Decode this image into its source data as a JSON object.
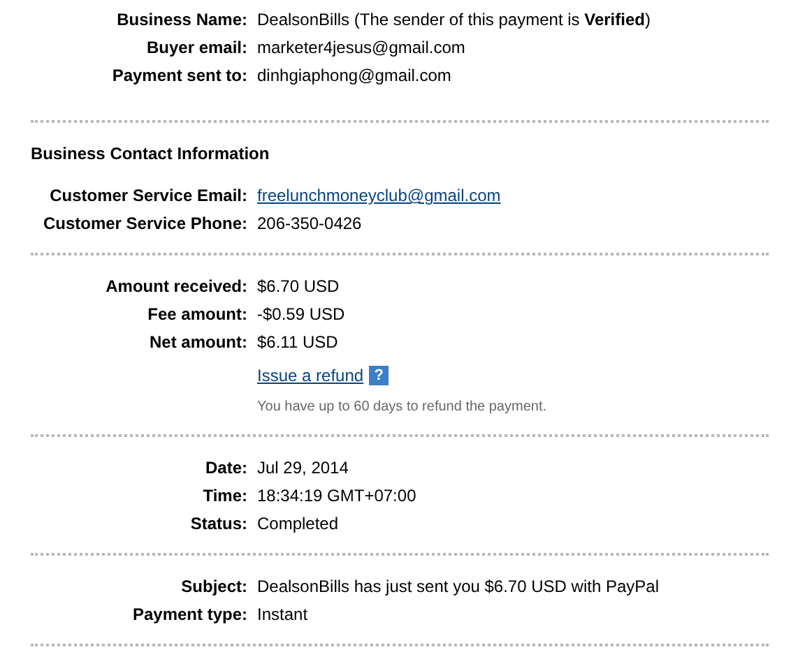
{
  "sections": [
    {
      "rows": [
        {
          "label": "Business Name:",
          "value": "DealsonBills (The sender of this payment is **Verified**)",
          "kind": "text"
        },
        {
          "label": "Buyer email:",
          "value": "marketer4jesus@gmail.com",
          "kind": "text"
        },
        {
          "label": "Payment sent to:",
          "value": "dinhgiaphong@gmail.com",
          "kind": "text"
        }
      ]
    },
    {
      "heading": "Business Contact Information",
      "rows": [
        {
          "label": "Customer Service Email:",
          "value": "freelunchmoneyclub@gmail.com",
          "kind": "link"
        },
        {
          "label": "Customer Service Phone:",
          "value": "206-350-0426",
          "kind": "text"
        }
      ]
    },
    {
      "rows": [
        {
          "label": "Amount received:",
          "value": "$6.70 USD",
          "kind": "text"
        },
        {
          "label": "Fee amount:",
          "value": "-$0.59 USD",
          "kind": "text"
        },
        {
          "label": "Net amount:",
          "value": "$6.11 USD",
          "kind": "text"
        }
      ],
      "refund": {
        "link": "Issue a refund",
        "help": "?",
        "note": "You have up to 60 days to refund the payment."
      }
    },
    {
      "rows": [
        {
          "label": "Date:",
          "value": "Jul 29, 2014",
          "kind": "text"
        },
        {
          "label": "Time:",
          "value": "18:34:19 GMT+07:00",
          "kind": "text"
        },
        {
          "label": "Status:",
          "value": "Completed",
          "kind": "text"
        }
      ]
    },
    {
      "rows": [
        {
          "label": "Subject:",
          "value": "DealsonBills has just sent you $6.70 USD with PayPal",
          "kind": "text"
        },
        {
          "label": "Payment type:",
          "value": "Instant",
          "kind": "text"
        }
      ]
    }
  ]
}
